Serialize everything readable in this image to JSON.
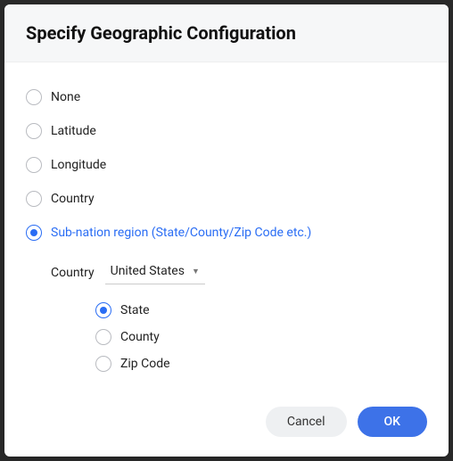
{
  "dialog": {
    "title": "Specify Geographic Configuration",
    "options": {
      "none": "None",
      "latitude": "Latitude",
      "longitude": "Longitude",
      "country": "Country",
      "subnation": "Sub-nation region (State/County/Zip Code etc.)"
    },
    "selected": "subnation",
    "sub": {
      "country_label": "Country",
      "country_value": "United States",
      "options": {
        "state": "State",
        "county": "County",
        "zip": "Zip Code"
      },
      "selected": "state"
    },
    "buttons": {
      "cancel": "Cancel",
      "ok": "OK"
    }
  }
}
